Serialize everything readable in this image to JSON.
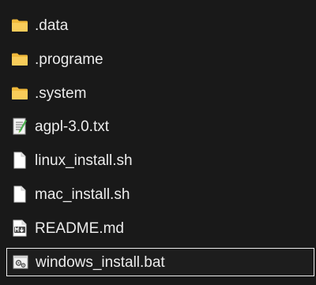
{
  "files": [
    {
      "name": ".data",
      "icon": "folder-icon",
      "type": "folder"
    },
    {
      "name": ".programe",
      "icon": "folder-icon",
      "type": "folder"
    },
    {
      "name": ".system",
      "icon": "folder-icon",
      "type": "folder"
    },
    {
      "name": "agpl-3.0.txt",
      "icon": "text-file-icon",
      "type": "text"
    },
    {
      "name": "linux_install.sh",
      "icon": "blank-file-icon",
      "type": "script"
    },
    {
      "name": "mac_install.sh",
      "icon": "blank-file-icon",
      "type": "script"
    },
    {
      "name": "README.md",
      "icon": "markdown-file-icon",
      "type": "markdown"
    },
    {
      "name": "windows_install.bat",
      "icon": "batch-file-icon",
      "type": "batch",
      "selected": true
    }
  ],
  "colors": {
    "background": "#191919",
    "text": "#ececec",
    "folder": "#f4c34a",
    "selection_border": "#ececec"
  }
}
